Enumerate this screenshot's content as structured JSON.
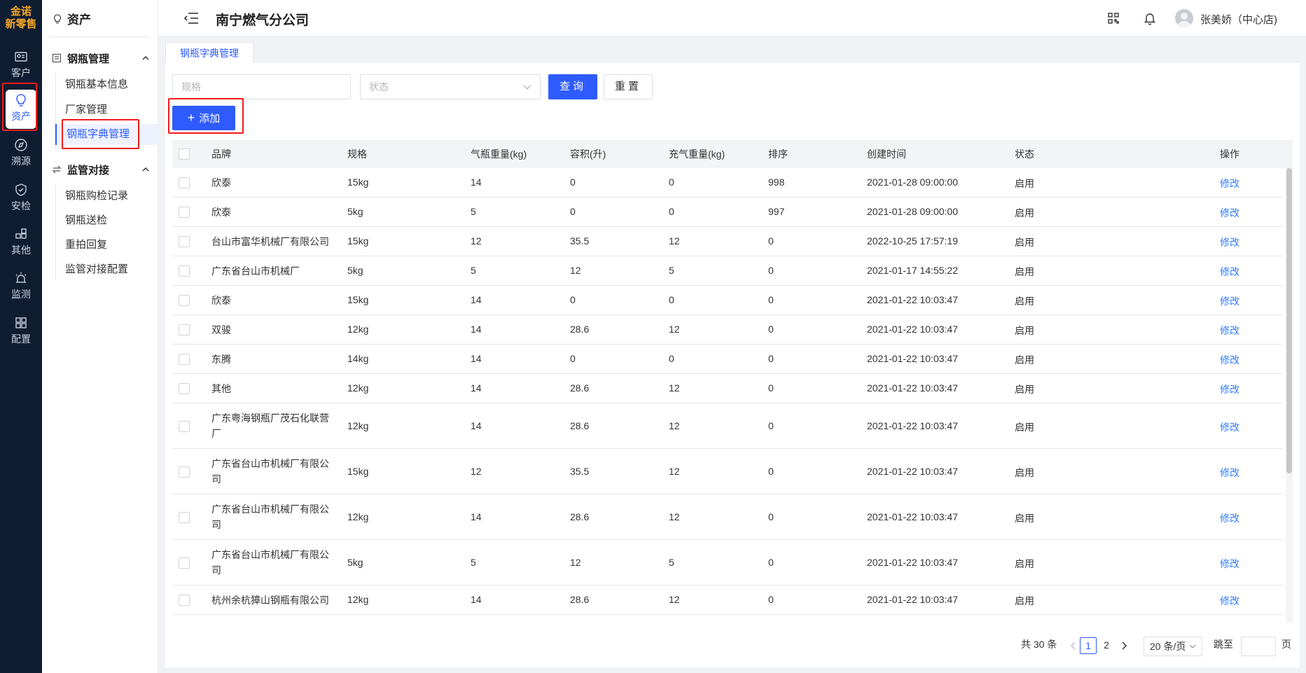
{
  "rail": {
    "logo_top": "金诺",
    "logo_bottom": "新零售",
    "items": [
      {
        "label": "客户",
        "icon": "id-card-icon"
      },
      {
        "label": "资产",
        "icon": "lightbulb-icon"
      },
      {
        "label": "溯源",
        "icon": "compass-icon"
      },
      {
        "label": "安检",
        "icon": "shield-icon"
      },
      {
        "label": "其他",
        "icon": "blocks-icon"
      },
      {
        "label": "监测",
        "icon": "alarm-icon"
      },
      {
        "label": "配置",
        "icon": "grid-icon"
      }
    ]
  },
  "sidebar": {
    "title": "资产",
    "groups": [
      {
        "label": "钢瓶管理",
        "items": [
          "钢瓶基本信息",
          "厂家管理",
          "钢瓶字典管理"
        ]
      },
      {
        "label": "监管对接",
        "items": [
          "钢瓶购检记录",
          "钢瓶送检",
          "重拍回复",
          "监管对接配置"
        ]
      }
    ],
    "active_item": "钢瓶字典管理"
  },
  "header": {
    "company": "南宁燃气分公司",
    "user": "张美娇（中心店)"
  },
  "tab": {
    "label": "钢瓶字典管理"
  },
  "filters": {
    "spec_placeholder": "规格",
    "status_placeholder": "状态",
    "query_label": "查询",
    "reset_label": "重置",
    "add_label": "添加"
  },
  "table": {
    "columns": [
      "品牌",
      "规格",
      "气瓶重量(kg)",
      "容积(升)",
      "充气重量(kg)",
      "排序",
      "创建时间",
      "状态",
      "操作"
    ],
    "rows": [
      {
        "brand": [
          "欣泰"
        ],
        "spec": "15kg",
        "weight": "14",
        "volume": "0",
        "fill": "0",
        "order": "998",
        "created": "2021-01-28 09:00:00",
        "status": "启用",
        "action": "修改"
      },
      {
        "brand": [
          "欣泰"
        ],
        "spec": "5kg",
        "weight": "5",
        "volume": "0",
        "fill": "0",
        "order": "997",
        "created": "2021-01-28 09:00:00",
        "status": "启用",
        "action": "修改"
      },
      {
        "brand": [
          "台山市富华机械厂有限公司"
        ],
        "spec": "15kg",
        "weight": "12",
        "volume": "35.5",
        "fill": "12",
        "order": "0",
        "created": "2022-10-25 17:57:19",
        "status": "启用",
        "action": "修改"
      },
      {
        "brand": [
          "广东省台山市机械厂"
        ],
        "spec": "5kg",
        "weight": "5",
        "volume": "12",
        "fill": "5",
        "order": "0",
        "created": "2021-01-17 14:55:22",
        "status": "启用",
        "action": "修改"
      },
      {
        "brand": [
          "欣泰"
        ],
        "spec": "15kg",
        "weight": "14",
        "volume": "0",
        "fill": "0",
        "order": "0",
        "created": "2021-01-22 10:03:47",
        "status": "启用",
        "action": "修改"
      },
      {
        "brand": [
          "双骏"
        ],
        "spec": "12kg",
        "weight": "14",
        "volume": "28.6",
        "fill": "12",
        "order": "0",
        "created": "2021-01-22 10:03:47",
        "status": "启用",
        "action": "修改"
      },
      {
        "brand": [
          "东腾"
        ],
        "spec": "14kg",
        "weight": "14",
        "volume": "0",
        "fill": "0",
        "order": "0",
        "created": "2021-01-22 10:03:47",
        "status": "启用",
        "action": "修改"
      },
      {
        "brand": [
          "其他"
        ],
        "spec": "12kg",
        "weight": "14",
        "volume": "28.6",
        "fill": "12",
        "order": "0",
        "created": "2021-01-22 10:03:47",
        "status": "启用",
        "action": "修改"
      },
      {
        "brand": [
          "广东粤海钢瓶厂茂石化联营",
          "厂"
        ],
        "spec": "12kg",
        "weight": "14",
        "volume": "28.6",
        "fill": "12",
        "order": "0",
        "created": "2021-01-22 10:03:47",
        "status": "启用",
        "action": "修改"
      },
      {
        "brand": [
          "广东省台山市机械厂有限公",
          "司"
        ],
        "spec": "15kg",
        "weight": "12",
        "volume": "35.5",
        "fill": "12",
        "order": "0",
        "created": "2021-01-22 10:03:47",
        "status": "启用",
        "action": "修改"
      },
      {
        "brand": [
          "广东省台山市机械厂有限公",
          "司"
        ],
        "spec": "12kg",
        "weight": "14",
        "volume": "28.6",
        "fill": "12",
        "order": "0",
        "created": "2021-01-22 10:03:47",
        "status": "启用",
        "action": "修改"
      },
      {
        "brand": [
          "广东省台山市机械厂有限公",
          "司"
        ],
        "spec": "5kg",
        "weight": "5",
        "volume": "12",
        "fill": "5",
        "order": "0",
        "created": "2021-01-22 10:03:47",
        "status": "启用",
        "action": "修改"
      },
      {
        "brand": [
          "杭州余杭獐山钢瓶有限公司"
        ],
        "spec": "12kg",
        "weight": "14",
        "volume": "28.6",
        "fill": "12",
        "order": "0",
        "created": "2021-01-22 10:03:47",
        "status": "启用",
        "action": "修改"
      }
    ]
  },
  "pagination": {
    "total": "共 30 条",
    "pages": [
      "1",
      "2"
    ],
    "current": "1",
    "page_size": "20 条/页",
    "jump_prefix": "跳至",
    "jump_suffix": "页"
  },
  "colors": {
    "primary": "#2e5bff",
    "rail_bg": "#0f1d33",
    "highlight": "#f21b1b"
  }
}
